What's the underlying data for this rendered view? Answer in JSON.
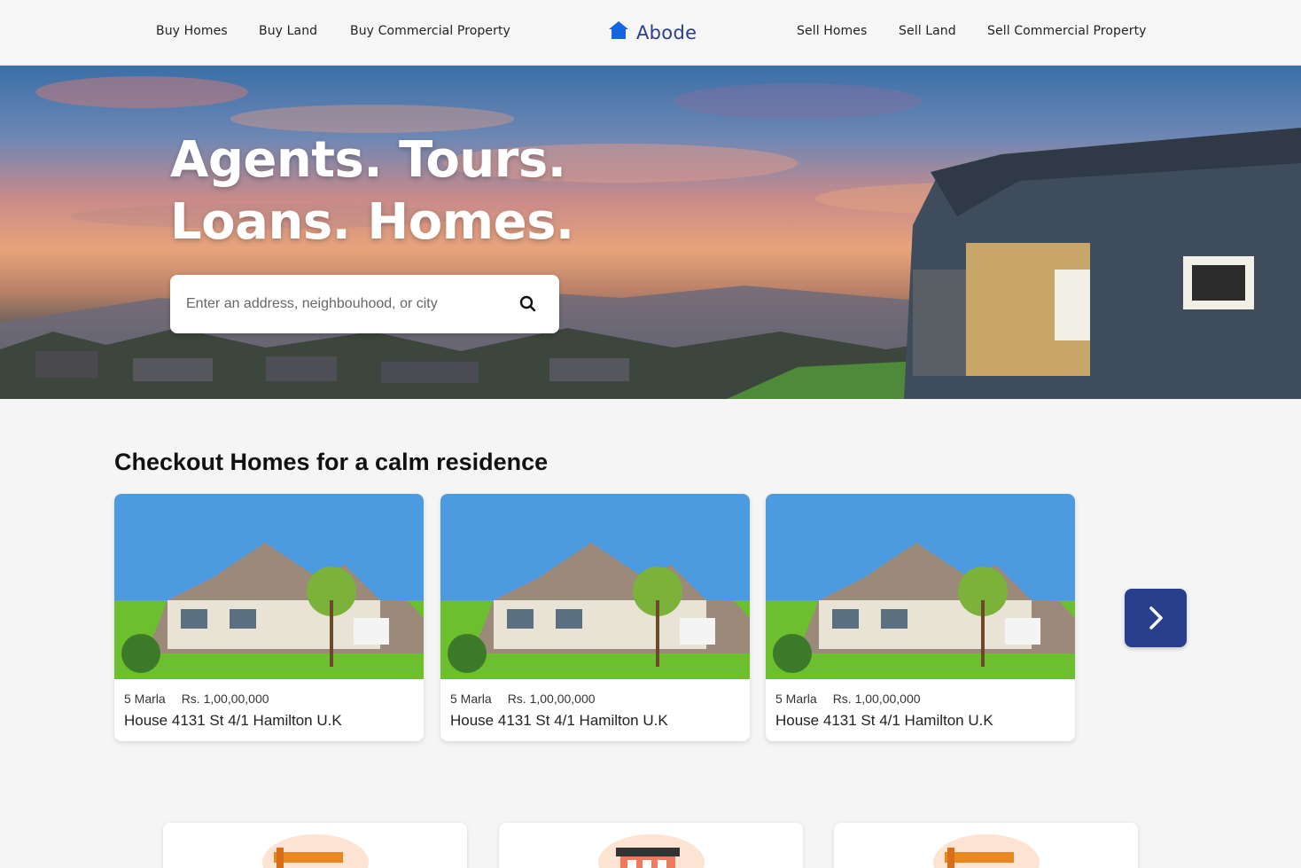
{
  "nav": {
    "left": [
      "Buy Homes",
      "Buy Land",
      "Buy Commercial Property"
    ],
    "right": [
      "Sell Homes",
      "Sell Land",
      "Sell Commercial Property"
    ],
    "brand": "Abode",
    "brand_icon": "house-icon"
  },
  "hero": {
    "title_line1": "Agents. Tours.",
    "title_line2": "Loans. Homes.",
    "search_placeholder": "Enter an address, neighbouhood, or city",
    "search_icon": "search-icon"
  },
  "section": {
    "title": "Checkout Homes for a calm residence"
  },
  "listings": [
    {
      "size": "5 Marla",
      "price": "Rs. 1,00,00,000",
      "address": "House 4131 St 4/1 Hamilton U.K"
    },
    {
      "size": "5 Marla",
      "price": "Rs. 1,00,00,000",
      "address": "House 4131 St 4/1 Hamilton U.K"
    },
    {
      "size": "5 Marla",
      "price": "Rs. 1,00,00,000",
      "address": "House 4131 St 4/1 Hamilton U.K"
    }
  ],
  "carousel": {
    "next_icon": "chevron-right-icon"
  },
  "colors": {
    "brand": "#2a3f8c",
    "brand_icon": "#1565e0"
  }
}
